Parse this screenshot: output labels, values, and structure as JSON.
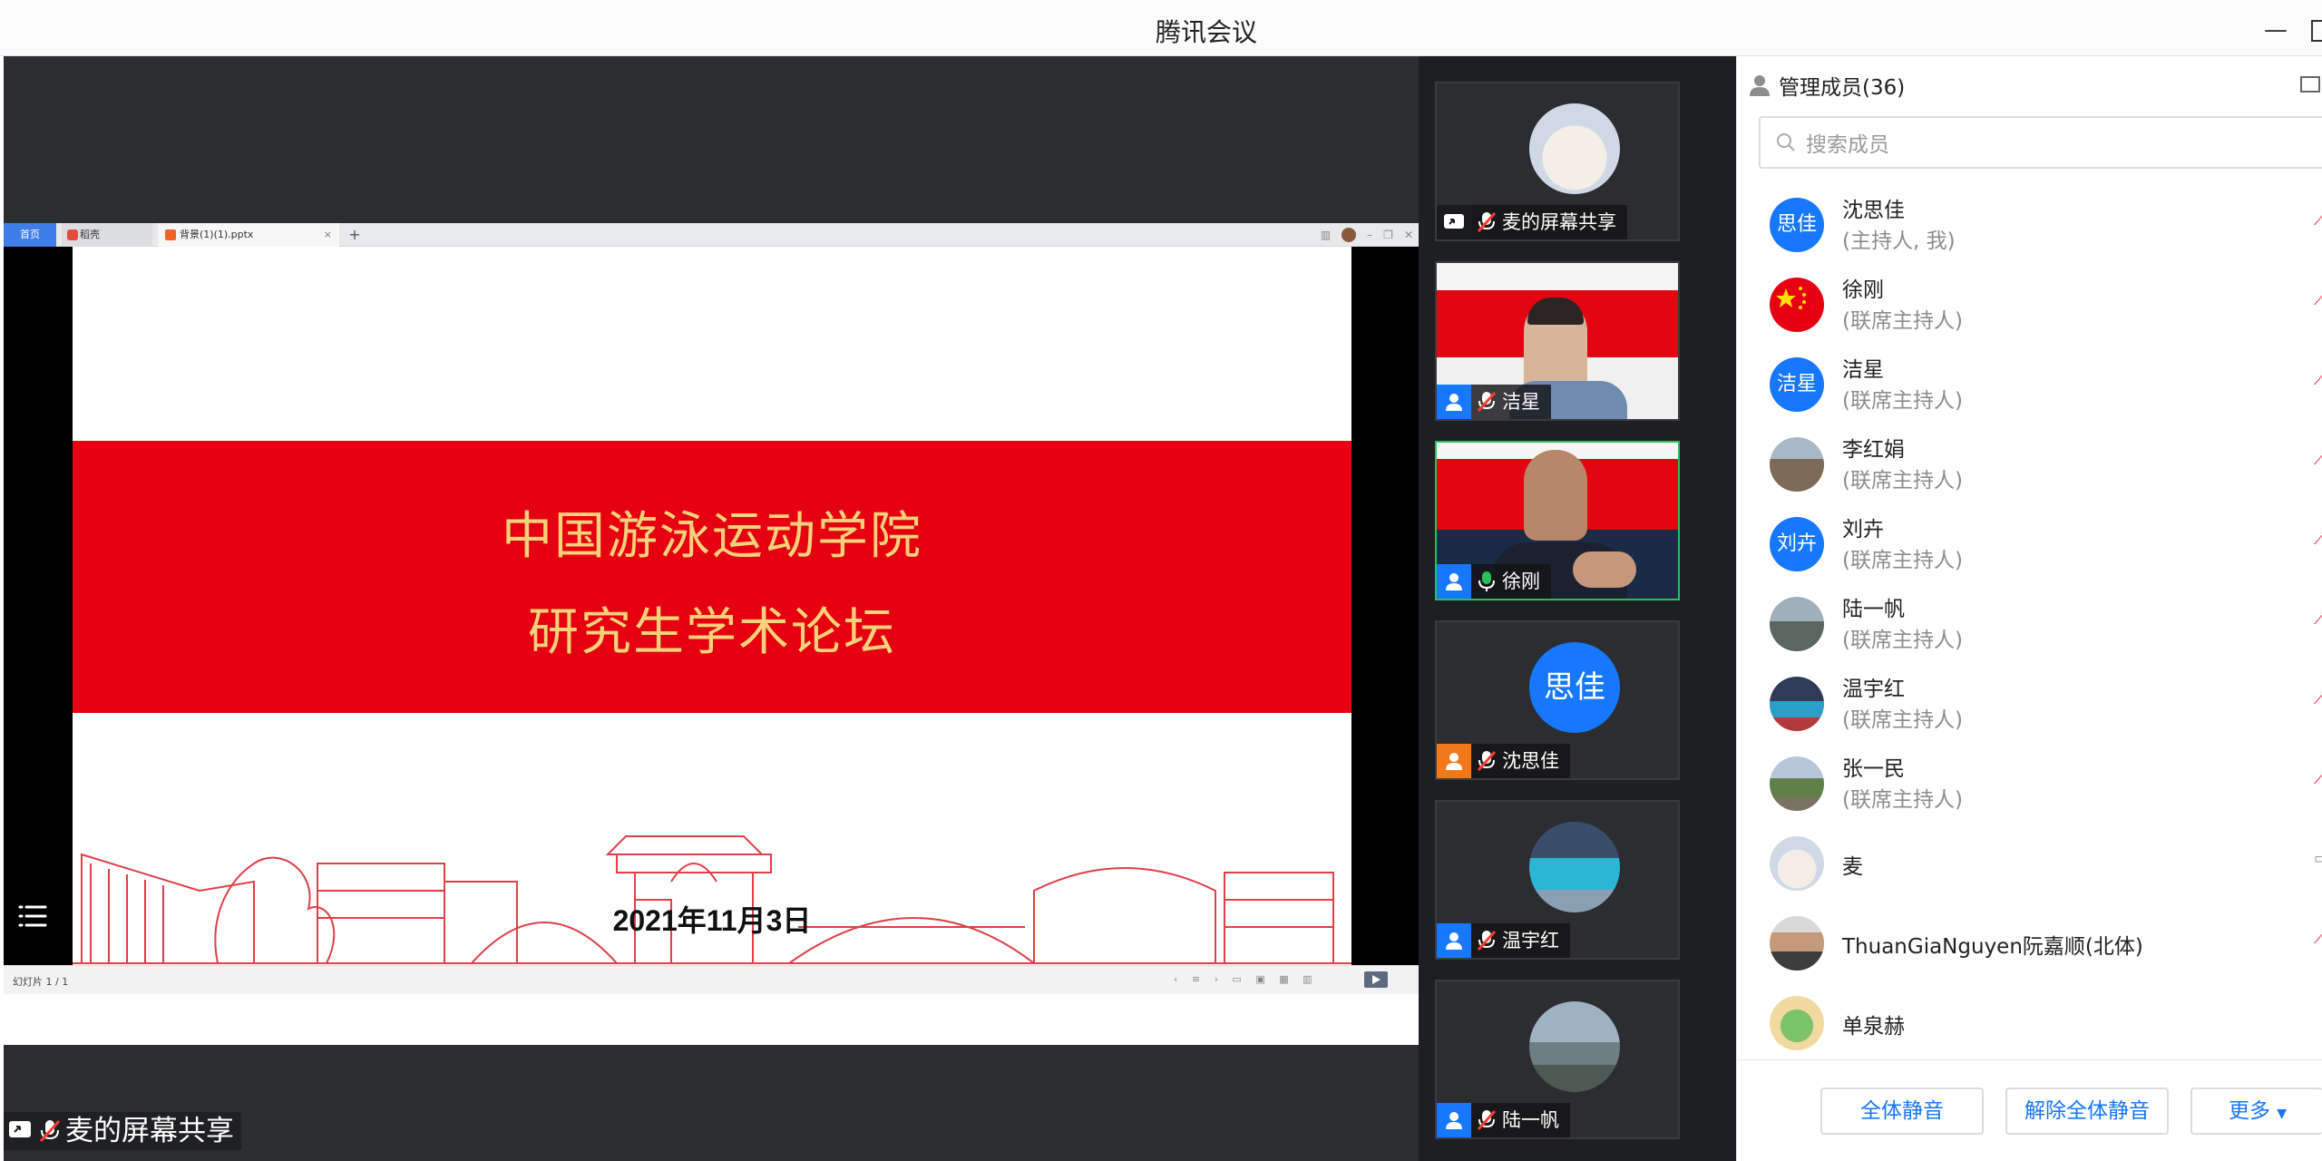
{
  "window": {
    "title": "腾讯会议"
  },
  "ppt": {
    "tabs": [
      "首页",
      "稻壳",
      "背景(1)(1).pptx"
    ],
    "slide_title_line1": "中国游泳运动学院",
    "slide_title_line2": "研究生学术论坛",
    "slide_date": "2021年11月3日",
    "slide_counter": "幻灯片 1 / 1"
  },
  "share_label": "麦的屏幕共享",
  "tiles": [
    {
      "name": "麦的屏幕共享",
      "kind": "avatar-image",
      "mic": "muted",
      "role": "share"
    },
    {
      "name": "洁星",
      "kind": "video",
      "mic": "muted",
      "role": "member"
    },
    {
      "name": "徐刚",
      "kind": "video",
      "mic": "active",
      "role": "member"
    },
    {
      "name": "沈思佳",
      "kind": "avatar-text",
      "avatar_text": "思佳",
      "mic": "muted",
      "role": "host"
    },
    {
      "name": "温宇红",
      "kind": "avatar-image",
      "mic": "muted",
      "role": "member"
    },
    {
      "name": "陆一帆",
      "kind": "avatar-image",
      "mic": "muted",
      "role": "member"
    }
  ],
  "members": {
    "title": "管理成员(36)",
    "search_placeholder": "搜索成员",
    "list": [
      {
        "name": "沈思佳",
        "role": "(主持人, 我)",
        "avatar_text": "思佳"
      },
      {
        "name": "徐刚",
        "role": "(联席主持人)",
        "avatar_icon": "china-flag"
      },
      {
        "name": "洁星",
        "role": "(联席主持人)",
        "avatar_text": "洁星"
      },
      {
        "name": "李红娟",
        "role": "(联席主持人)",
        "avatar_icon": "photo"
      },
      {
        "name": "刘卉",
        "role": "(联席主持人)",
        "avatar_text": "刘卉"
      },
      {
        "name": "陆一帆",
        "role": "(联席主持人)",
        "avatar_icon": "photo"
      },
      {
        "name": "温宇红",
        "role": "(联席主持人)",
        "avatar_icon": "photo"
      },
      {
        "name": "张一民",
        "role": "(联席主持人)",
        "avatar_icon": "photo"
      },
      {
        "name": "麦",
        "role": "",
        "avatar_icon": "cat"
      },
      {
        "name": "ThuanGiaNguyen阮嘉顺(北体)",
        "role": "",
        "avatar_icon": "photo"
      },
      {
        "name": "单泉赫",
        "role": "",
        "avatar_icon": "cartoon"
      }
    ]
  },
  "footer": {
    "mute_all": "全体静音",
    "unmute_all": "解除全体静音",
    "more": "更多"
  }
}
